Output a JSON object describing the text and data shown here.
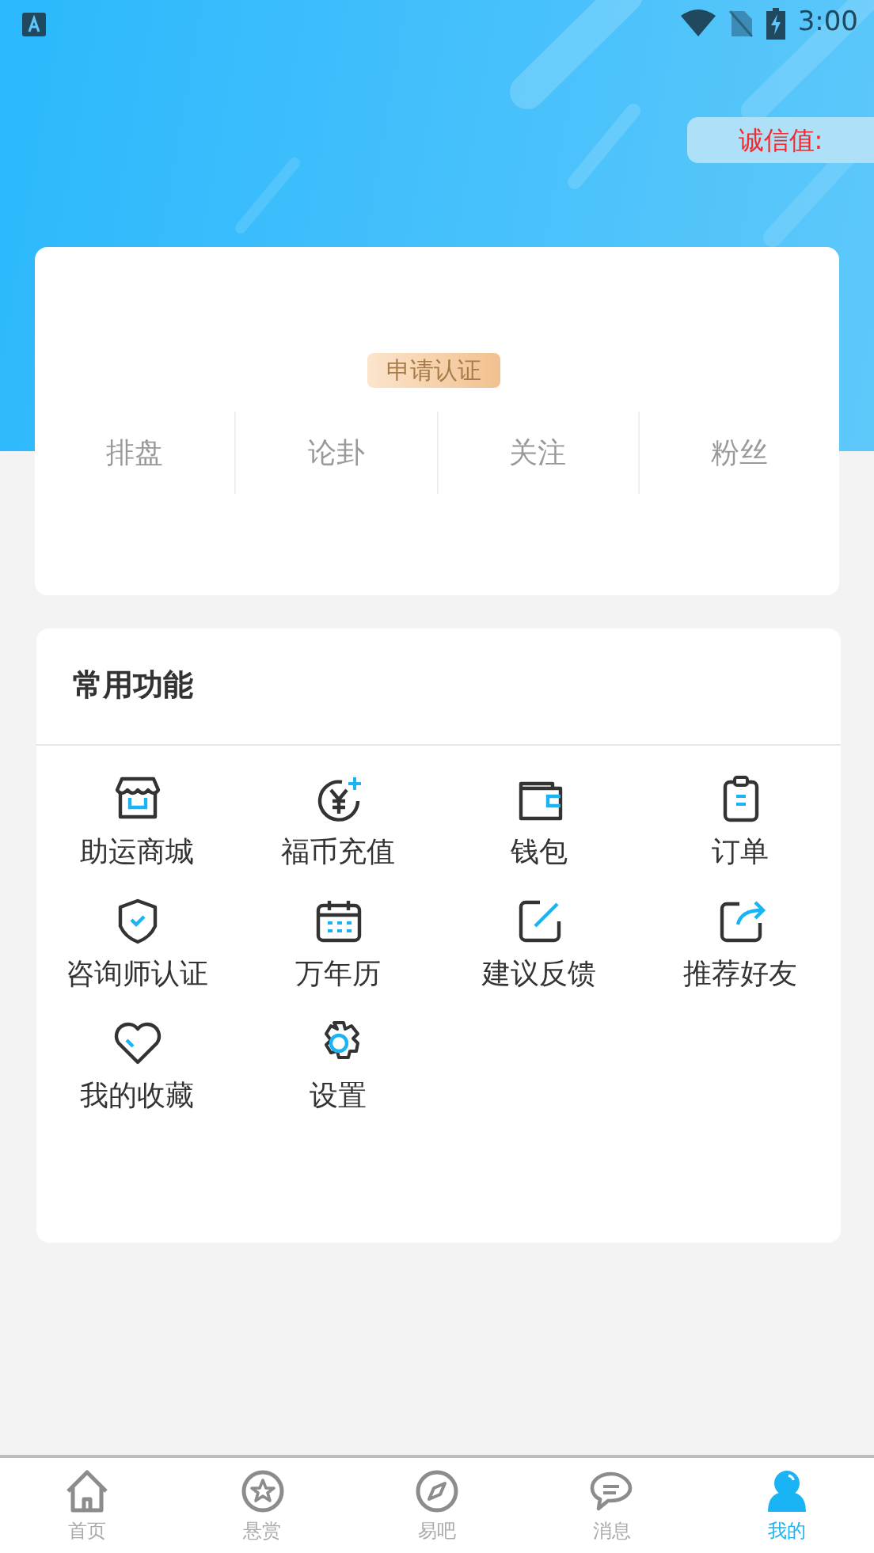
{
  "status_bar": {
    "time": "3:00"
  },
  "header": {
    "credit_label": "诚信值:"
  },
  "profile": {
    "certify_button": "申请认证",
    "stats": [
      {
        "label": "排盘"
      },
      {
        "label": "论卦"
      },
      {
        "label": "关注"
      },
      {
        "label": "粉丝"
      }
    ]
  },
  "functions": {
    "title": "常用功能",
    "items": [
      {
        "kind": "shop",
        "label": "助运商城"
      },
      {
        "kind": "coin",
        "label": "福币充值"
      },
      {
        "kind": "wallet",
        "label": "钱包"
      },
      {
        "kind": "order",
        "label": "订单"
      },
      {
        "kind": "shield",
        "label": "咨询师认证"
      },
      {
        "kind": "calendar",
        "label": "万年历"
      },
      {
        "kind": "edit",
        "label": "建议反馈"
      },
      {
        "kind": "share",
        "label": "推荐好友"
      },
      {
        "kind": "heart",
        "label": "我的收藏"
      },
      {
        "kind": "gear",
        "label": "设置"
      }
    ]
  },
  "tab_bar": [
    {
      "kind": "home",
      "label": "首页",
      "selected": false
    },
    {
      "kind": "reward",
      "label": "悬赏",
      "selected": false
    },
    {
      "kind": "compass",
      "label": "易吧",
      "selected": false
    },
    {
      "kind": "chat",
      "label": "消息",
      "selected": false
    },
    {
      "kind": "user",
      "label": "我的",
      "selected": true
    }
  ]
}
